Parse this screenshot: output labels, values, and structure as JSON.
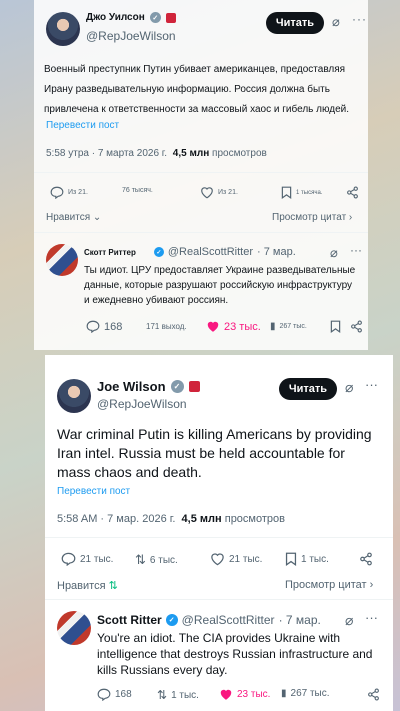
{
  "top_card": {
    "author": {
      "name": "Джо Уилсон",
      "handle": "@RepJoeWilson"
    },
    "follow_label": "Читать",
    "tweet_text": "Военный преступник Путин убивает американцев, предоставляя Ирану разведывательную информацию. Россия должна быть привлечена к ответственности за массовый хаос и гибель людей.",
    "translate_label": "Перевести пост",
    "timestamp": "5:58 утра · 7 марта 2026 г.",
    "views_count": "4,5 млн",
    "views_label": "просмотров",
    "actions": {
      "replies": "Из 21.",
      "reposts": "76 тысяч.",
      "likes": "Из 21.",
      "bookmarks": "1 тысяча."
    },
    "likes_label": "Нравится",
    "quotes_label": "Просмотр цитат",
    "reply": {
      "name": "Скотт Риттер",
      "handle": "@RealScottRitter",
      "date": "· 7 мар.",
      "text": "Ты идиот. ЦРУ предоставляет Украине разведывательные данные, которые разрушают российскую инфраструктуру и ежедневно убивают россиян.",
      "replies": "168",
      "reposts": "171 выход.",
      "likes": "23 тыс.",
      "views": "267 тыс."
    }
  },
  "bottom_card": {
    "author": {
      "name": "Joe Wilson",
      "handle": "@RepJoeWilson"
    },
    "follow_label": "Читать",
    "tweet_text": "War criminal Putin is killing Americans by providing Iran intel. Russia must be held accountable for mass chaos and death.",
    "translate_label": "Перевести пост",
    "timestamp": "5:58 AM · 7 мар. 2026 г.",
    "views_count": "4,5 млн",
    "views_label": "просмотров",
    "actions": {
      "replies": "21 тыс.",
      "reposts": "6 тыс.",
      "likes": "21 тыс.",
      "bookmarks": "1 тыс."
    },
    "likes_label": "Нравится",
    "quotes_label": "Просмотр цитат",
    "reply": {
      "name": "Scott Ritter",
      "handle": "@RealScottRitter",
      "date": "· 7 мар.",
      "text": "You're an idiot. The CIA provides Ukraine with intelligence that destroys Russian infrastructure and kills Russians every day.",
      "replies": "168",
      "reposts": "1 тыс.",
      "likes": "23 тыс.",
      "views": "267 тыс."
    }
  },
  "colors": {
    "link": "#1d9bf0",
    "like": "#f91880",
    "verified_blue": "#1d9bf0",
    "verified_gray": "#829aab",
    "button": "#0f1419"
  }
}
